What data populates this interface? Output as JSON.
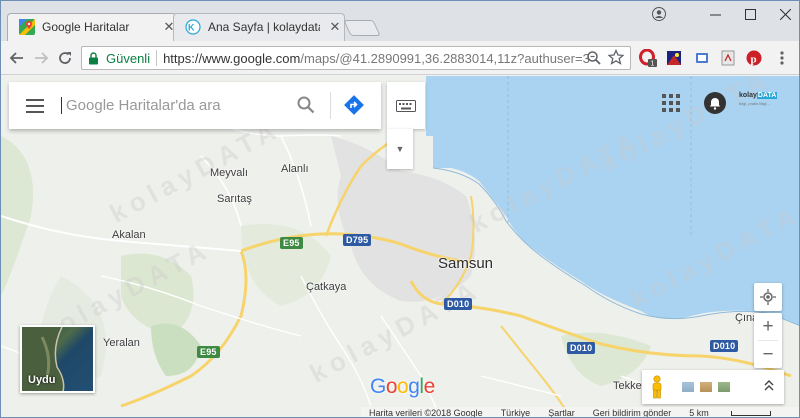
{
  "tabs": [
    {
      "title": "Google Haritalar",
      "favicon": "google-maps-icon",
      "active": true
    },
    {
      "title": "Ana Sayfa | kolaydata.com",
      "favicon": "kolaydata-icon",
      "active": false
    }
  ],
  "omnibox": {
    "secure_label": "Güvenli",
    "url_host": "https://www.google.com",
    "url_path": "/maps/@41.2890991,36.2883014,11z?authuser=3"
  },
  "extensions": [
    "opera-icon",
    "vpn-icon",
    "cast-icon",
    "pdf-icon",
    "pinterest-icon"
  ],
  "search": {
    "placeholder": "Google Haritalar'da ara"
  },
  "account": {
    "logo_text_1": "kolay",
    "logo_text_2": "DATA",
    "logo_sub": "bilgi, pratik bilgi..."
  },
  "map": {
    "labels": {
      "meyvali": "Meyvalı",
      "alanli": "Alanlı",
      "saritas": "Sarıtaş",
      "akalan": "Akalan",
      "samsun": "Samsun",
      "catkaya": "Çatkaya",
      "yeralan": "Yeralan",
      "cinar": "Çına",
      "tekke": "Tekke"
    },
    "shields": {
      "e95_north": "E95",
      "e95_south": "E95",
      "d795": "D795",
      "d010_center": "D010",
      "d010_east": "D010",
      "d010_far": "D010"
    },
    "watermark": "kolayDATA",
    "satellite_label": "Uydu",
    "google_logo": [
      "G",
      "o",
      "o",
      "g",
      "l",
      "e"
    ],
    "google_logo_colors": [
      "#4285f4",
      "#ea4335",
      "#fbbc05",
      "#4285f4",
      "#34a853",
      "#ea4335"
    ]
  },
  "footer": {
    "map_data": "Harita verileri ©2018 Google",
    "country": "Türkiye",
    "terms": "Şartlar",
    "feedback": "Geri bildirim gönder",
    "scale": "5 km"
  }
}
